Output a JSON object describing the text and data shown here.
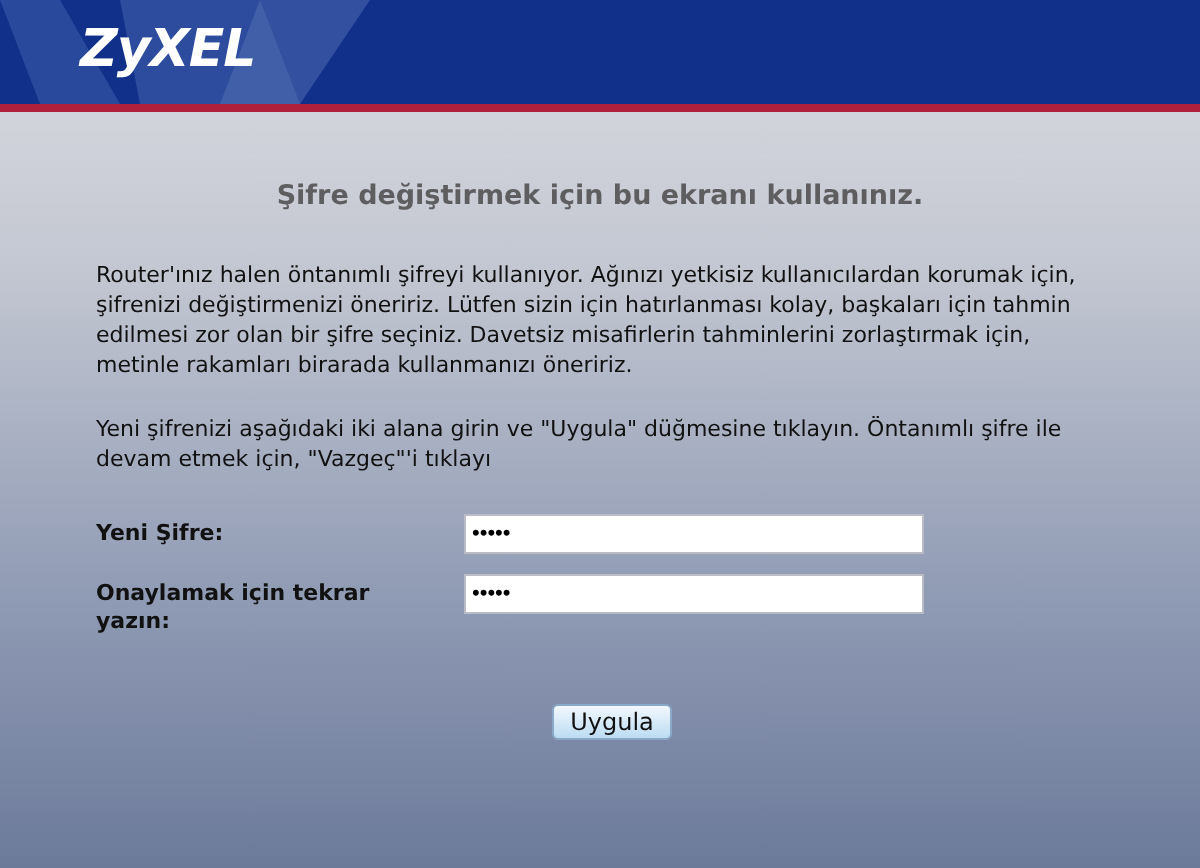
{
  "header": {
    "logo": "ZyXEL"
  },
  "heading": "Şifre değiştirmek için bu ekranı kullanınız.",
  "paragraphs": [
    "Router'ınız halen öntanımlı şifreyi kullanıyor. Ağınızı yetkisiz kullanıcılardan korumak için, şifrenizi değiştirmenizi öneririz. Lütfen sizin için hatırlanması kolay, başkaları için tahmin edilmesi zor olan bir şifre seçiniz. Davetsiz misafirlerin tahminlerini zorlaştırmak için, metinle rakamları birarada kullanmanızı öneririz.",
    "Yeni şifrenizi aşağıdaki iki alana girin ve \"Uygula\" düğmesine tıklayın. Öntanımlı şifre ile devam etmek için, \"Vazgeç\"'i tıklayı"
  ],
  "fields": [
    {
      "label": "Yeni Şifre:",
      "value": "•••••"
    },
    {
      "label": "Onaylamak için tekrar yazın:",
      "value": "•••••"
    }
  ],
  "button": "Uygula"
}
